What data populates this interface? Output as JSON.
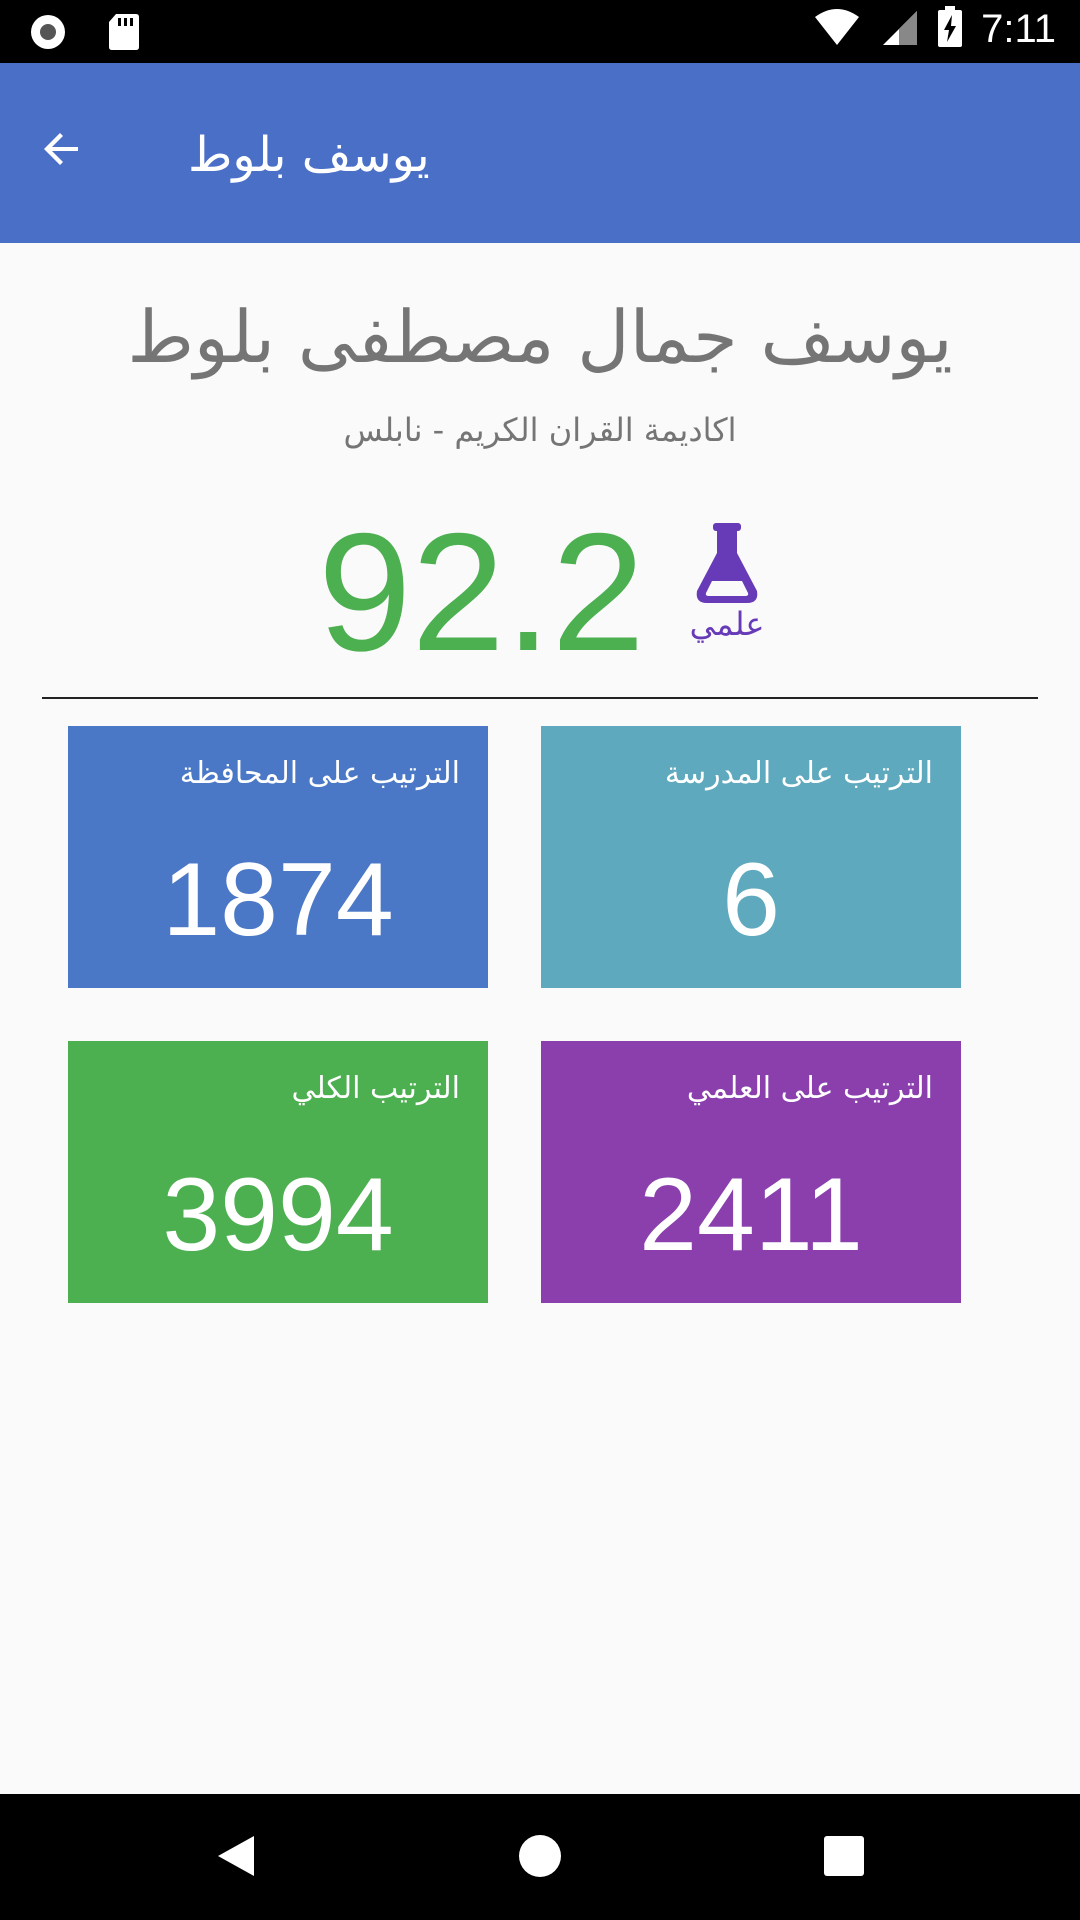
{
  "status_bar": {
    "time": "7:11",
    "icons": [
      "record-icon",
      "sd-card-icon",
      "wifi-icon",
      "signal-icon",
      "battery-charging-icon"
    ]
  },
  "app_bar": {
    "title": "يوسف بلوط",
    "back_icon": "arrow-back-icon",
    "color": "#4a6fc6"
  },
  "student": {
    "full_name": "يوسف جمال مصطفى بلوط",
    "school": "اكاديمة القران الكريم - نابلس",
    "score": "92.2",
    "score_color": "#4caf50",
    "branch_label": "علمي",
    "branch_icon": "flask-icon",
    "branch_color": "#673ab7"
  },
  "rankings": [
    {
      "label": "الترتيب على المحافظة",
      "value": "1874",
      "color": "#4a78c7"
    },
    {
      "label": "الترتيب على المدرسة",
      "value": "6",
      "color": "#5ea9bd"
    },
    {
      "label": "الترتيب الكلي",
      "value": "3994",
      "color": "#4caf50"
    },
    {
      "label": "الترتيب على العلمي",
      "value": "2411",
      "color": "#8a3fad"
    }
  ],
  "nav_bar": {
    "icons": [
      "back-triangle-icon",
      "home-circle-icon",
      "recents-square-icon"
    ]
  }
}
